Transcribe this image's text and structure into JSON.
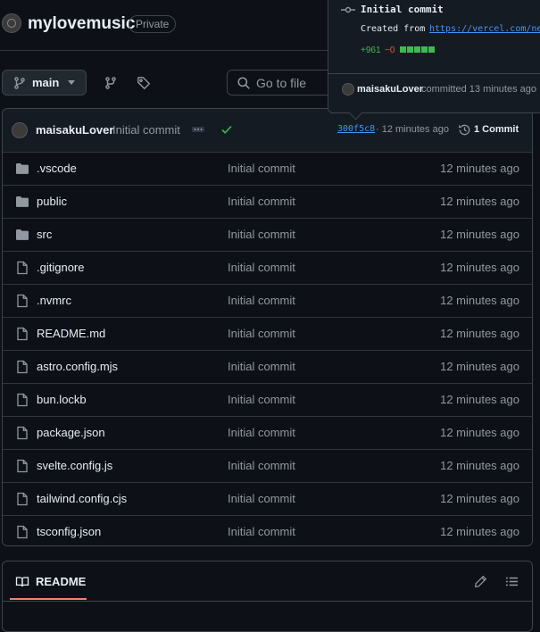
{
  "repo": {
    "name": "mylovemusic",
    "visibility": "Private"
  },
  "toolbar": {
    "branch": "main",
    "goto_placeholder": "Go to file"
  },
  "latest_commit": {
    "author": "maisakuLover",
    "message": "Initial commit",
    "hash": "300f5c8",
    "time": "· 12 minutes ago",
    "count_label": "1 Commit",
    "status": "success"
  },
  "files": [
    {
      "name": ".vscode",
      "type": "folder",
      "message": "Initial commit",
      "time": "12 minutes ago"
    },
    {
      "name": "public",
      "type": "folder",
      "message": "Initial commit",
      "time": "12 minutes ago"
    },
    {
      "name": "src",
      "type": "folder",
      "message": "Initial commit",
      "time": "12 minutes ago"
    },
    {
      "name": ".gitignore",
      "type": "file",
      "message": "Initial commit",
      "time": "12 minutes ago"
    },
    {
      "name": ".nvmrc",
      "type": "file",
      "message": "Initial commit",
      "time": "12 minutes ago"
    },
    {
      "name": "README.md",
      "type": "file",
      "message": "Initial commit",
      "time": "12 minutes ago"
    },
    {
      "name": "astro.config.mjs",
      "type": "file",
      "message": "Initial commit",
      "time": "12 minutes ago"
    },
    {
      "name": "bun.lockb",
      "type": "file",
      "message": "Initial commit",
      "time": "12 minutes ago"
    },
    {
      "name": "package.json",
      "type": "file",
      "message": "Initial commit",
      "time": "12 minutes ago"
    },
    {
      "name": "svelte.config.js",
      "type": "file",
      "message": "Initial commit",
      "time": "12 minutes ago"
    },
    {
      "name": "tailwind.config.cjs",
      "type": "file",
      "message": "Initial commit",
      "time": "12 minutes ago"
    },
    {
      "name": "tsconfig.json",
      "type": "file",
      "message": "Initial commit",
      "time": "12 minutes ago"
    }
  ],
  "readme": {
    "tab_label": "README"
  },
  "popover": {
    "title": "Initial commit",
    "created_prefix": "Created from",
    "created_link": "https://vercel.com/ne",
    "additions": "+961",
    "deletions": "−0",
    "author": "maisakuLover",
    "committed": "committed 13 minutes ago"
  },
  "colors": {
    "bg": "#0d1117",
    "border": "#3d444d",
    "text": "#e6edf3",
    "muted": "#9198a1",
    "link": "#4493f8",
    "success": "#3fb950",
    "danger": "#f85149",
    "accent_underline": "#f78166"
  }
}
